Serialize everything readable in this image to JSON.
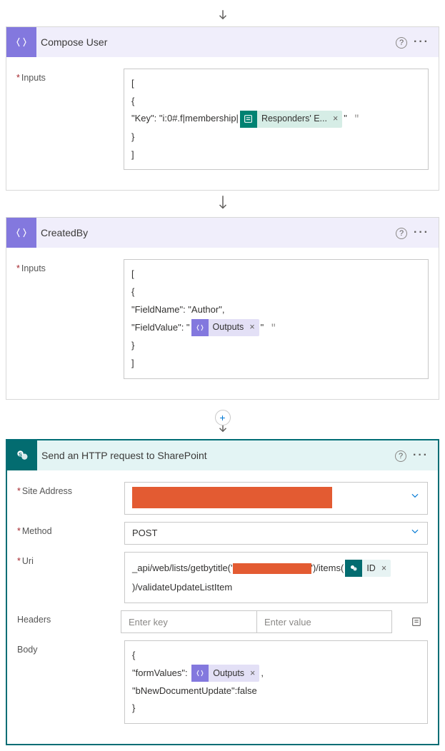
{
  "arrow_glyph": "↓",
  "card1": {
    "title": "Compose User",
    "label_inputs": "Inputs",
    "code_line1": "[",
    "code_line2": "  {",
    "code_line3_pre": "    \"Key\": \"i:0#.f|membership|",
    "code_line3_post": "\"",
    "code_line4": "  }",
    "code_line5": "]",
    "token_label": "Responders' E...",
    "token_x": "×"
  },
  "card2": {
    "title": "CreatedBy",
    "label_inputs": "Inputs",
    "code_line1": "[",
    "code_line2": "  {",
    "code_line3": "    \"FieldName\": \"Author\",",
    "code_line4_pre": "    \"FieldValue\": \"",
    "code_line4_post": "\"",
    "code_line5": "  }",
    "code_line6": "]",
    "token_label": "Outputs",
    "token_x": "×"
  },
  "plus": "+",
  "card3": {
    "title": "Send an HTTP request to SharePoint",
    "label_site": "Site Address",
    "label_method": "Method",
    "method_value": "POST",
    "label_uri": "Uri",
    "uri_pre": "_api/web/lists/getbytitle('",
    "uri_mid": "')/items(",
    "uri_token_id": "ID",
    "uri_token_x": "×",
    "uri_line2": ")/validateUpdateListItem",
    "label_headers": "Headers",
    "hdr_key_ph": "Enter key",
    "hdr_val_ph": "Enter value",
    "label_body": "Body",
    "body_line1": "{",
    "body_line2_pre": "\"formValues\":",
    "body_line2_post": ",",
    "body_token_label": "Outputs",
    "body_token_x": "×",
    "body_line3": "\"bNewDocumentUpdate\":false",
    "body_line4": "}"
  },
  "help_glyph": "?",
  "more_glyph": "···"
}
